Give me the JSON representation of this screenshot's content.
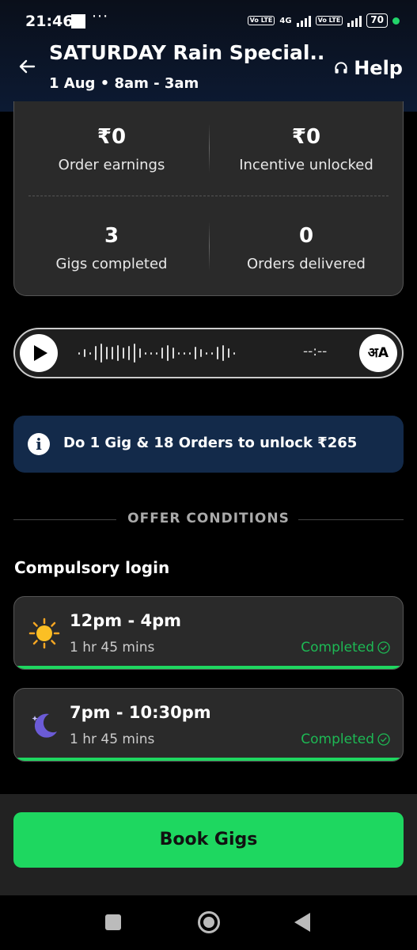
{
  "status_bar": {
    "time": "21:46",
    "dots": "···",
    "network": "4G",
    "volte": "Vo LTE",
    "battery": "70"
  },
  "header": {
    "title": "SATURDAY Rain Special...",
    "subtitle": "1 Aug • 8am - 3am",
    "help_label": "Help"
  },
  "stats": {
    "order_earnings": {
      "value": "₹0",
      "label": "Order earnings"
    },
    "incentive_unlocked": {
      "value": "₹0",
      "label": "Incentive unlocked"
    },
    "gigs_completed": {
      "value": "3",
      "label": "Gigs completed"
    },
    "orders_delivered": {
      "value": "0",
      "label": "Orders delivered"
    }
  },
  "audio": {
    "duration": "--:--",
    "lang_label": "अA"
  },
  "info_banner": {
    "text": "Do 1 Gig & 18 Orders to unlock ₹265"
  },
  "offer_conditions": {
    "heading": "OFFER CONDITIONS"
  },
  "compulsory_login": {
    "title": "Compulsory login",
    "slots": [
      {
        "time": "12pm - 4pm",
        "duration": "1 hr 45 mins",
        "status": "Completed",
        "icon": "sun-icon",
        "progress": 1.0
      },
      {
        "time": "7pm - 10:30pm",
        "duration": "1 hr 45 mins",
        "status": "Completed",
        "icon": "moon-icon",
        "progress": 1.0
      }
    ]
  },
  "actions": {
    "book_gigs": "Book Gigs"
  },
  "colors": {
    "accent_green": "#1ed760",
    "banner_blue": "#132a4a",
    "card_bg": "#2a2a2a"
  }
}
